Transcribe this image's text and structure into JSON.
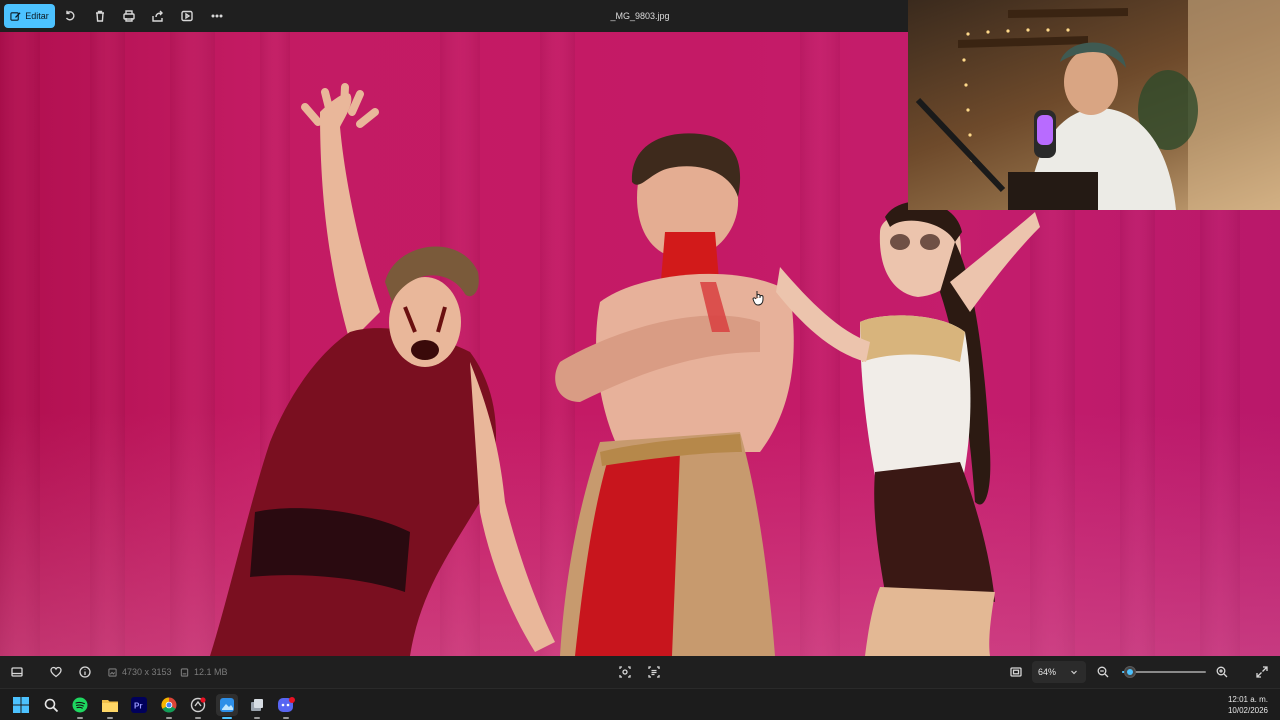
{
  "window": {
    "filename": "_MG_9803.jpg"
  },
  "toolbar": {
    "edit_label": "Editar",
    "edit_icon": "edit-photo-icon",
    "icons": [
      "rotate-icon",
      "delete-icon",
      "print-icon",
      "share-icon",
      "slideshow-icon",
      "more-icon"
    ]
  },
  "infobar": {
    "dimensions": "4730 x 3153",
    "file_size": "12.1 MB",
    "zoom_value": "64%",
    "zoom_level": 0.1,
    "icons": [
      "filmstrip-icon",
      "favorite-icon",
      "info-icon",
      "crop-icon",
      "ocr-icon",
      "fit-window-icon",
      "zoom-out-icon",
      "zoom-in-icon",
      "fullscreen-icon"
    ]
  },
  "taskbar": {
    "apps": [
      "windows-start-icon",
      "search-icon",
      "spotify-icon",
      "file-explorer-icon",
      "premiere-pro-icon",
      "chrome-icon",
      "app-icon",
      "photos-icon",
      "app-icon",
      "discord-icon"
    ],
    "time": "12:01 a. m.",
    "date": "10/02/2026"
  },
  "colors": {
    "accent": "#4cc2ff",
    "bar_background": "#1f1f1f",
    "photo_backdrop": "#c41a66"
  }
}
